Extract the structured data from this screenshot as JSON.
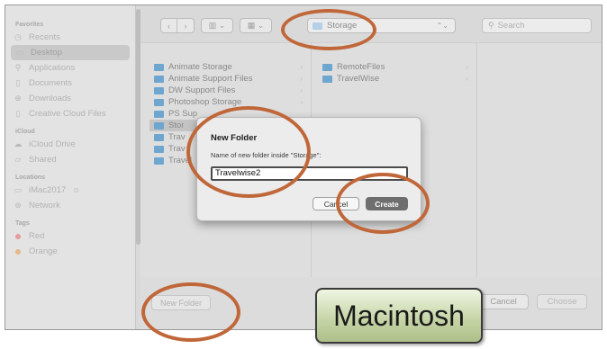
{
  "sidebar": {
    "favorites_label": "Favorites",
    "favorites": [
      {
        "label": "Recents",
        "icon": "clock-icon"
      },
      {
        "label": "Desktop",
        "icon": "desktop-icon",
        "selected": true
      },
      {
        "label": "Applications",
        "icon": "applications-icon"
      },
      {
        "label": "Documents",
        "icon": "document-icon"
      },
      {
        "label": "Downloads",
        "icon": "download-icon"
      },
      {
        "label": "Creative Cloud Files",
        "icon": "document-icon"
      }
    ],
    "icloud_label": "iCloud",
    "icloud": [
      {
        "label": "iCloud Drive",
        "icon": "cloud-icon"
      },
      {
        "label": "Shared",
        "icon": "shared-folder-icon"
      }
    ],
    "locations_label": "Locations",
    "locations": [
      {
        "label": "iMac2017",
        "icon": "computer-icon",
        "suffix": "⊜"
      },
      {
        "label": "Network",
        "icon": "globe-icon"
      }
    ],
    "tags_label": "Tags",
    "tags": [
      {
        "label": "Red",
        "color": "#e39c9c"
      },
      {
        "label": "Orange",
        "color": "#e6b98a"
      }
    ]
  },
  "toolbar": {
    "back": "‹",
    "forward": "›",
    "view_columns": "▥ ⌄",
    "view_grid": "▦ ⌄",
    "location": "Storage",
    "location_arrows": "⌃⌄",
    "search_placeholder": "Search"
  },
  "browser": {
    "column1": [
      {
        "label": "Animate Storage"
      },
      {
        "label": "Animate Support Files"
      },
      {
        "label": "DW Support Files"
      },
      {
        "label": "Photoshop Storage"
      },
      {
        "label": "PS Sup"
      },
      {
        "label": "Stor",
        "selected": true
      },
      {
        "label": "Trav"
      },
      {
        "label": "Trav"
      },
      {
        "label": "Travel"
      }
    ],
    "column2": [
      {
        "label": "RemoteFiles"
      },
      {
        "label": "TravelWise"
      }
    ],
    "column_handle": "⏸"
  },
  "bottom": {
    "new_folder": "New Folder",
    "cancel": "Cancel",
    "choose": "Choose"
  },
  "dialog": {
    "title": "New Folder",
    "prompt": "Name of new folder inside \"Storage\":",
    "input_value": "Travelwise2",
    "cancel": "Cancel",
    "create": "Create"
  },
  "caption": "Macintosh",
  "colors": {
    "highlight_ring": "#c0673a",
    "folder_blue": "#6fa6cf",
    "create_button": "#6e6e6e"
  }
}
